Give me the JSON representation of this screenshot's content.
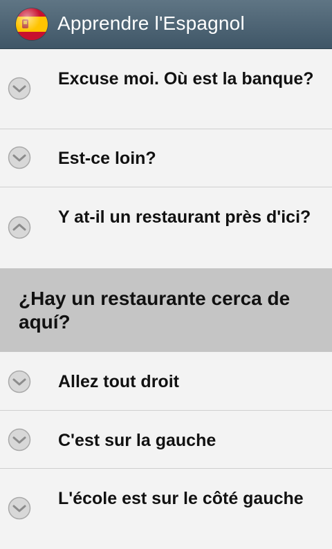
{
  "app": {
    "title": "Apprendre l'Espagnol",
    "icon": "spain-flag-icon",
    "action_bar_color": "#4e6576"
  },
  "phrases": [
    {
      "text": "Excuse moi. Où est la banque?",
      "expanded": false
    },
    {
      "text": "Est-ce loin?",
      "expanded": false
    },
    {
      "text": "Y at-il un restaurant près d'ici?",
      "expanded": true,
      "translation": "¿Hay un restaurante cerca de aquí?"
    },
    {
      "text": "Allez tout droit",
      "expanded": false
    },
    {
      "text": "C'est sur la gauche",
      "expanded": false
    },
    {
      "text": "L'école est sur le côté gauche",
      "expanded": false
    }
  ],
  "colors": {
    "list_background": "#f3f3f3",
    "answer_background": "#c5c5c5",
    "divider": "#cfcfcf"
  }
}
